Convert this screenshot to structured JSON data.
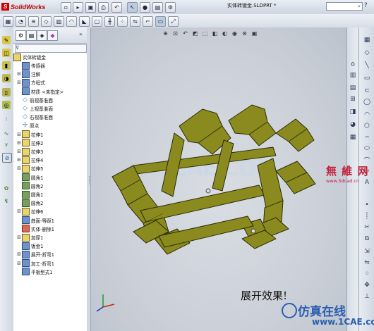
{
  "app": {
    "logo": "SolidWorks",
    "document_title": "实体转钣金.SLDPRT *",
    "search_placeholder": ""
  },
  "toolbar": {
    "top_icons": [
      "new-icon",
      "open-icon",
      "save-icon",
      "print-icon",
      "undo-icon",
      "select-icon",
      "rebuild-icon",
      "options-icon"
    ]
  },
  "feature_tree": {
    "root": "实体转钣金",
    "items": [
      {
        "label": "传感器",
        "icon": "sensor-icon",
        "expandable": false
      },
      {
        "label": "注解",
        "icon": "annotation-icon",
        "expandable": true
      },
      {
        "label": "方程式",
        "icon": "equation-icon",
        "expandable": true
      },
      {
        "label": "材质 <未指定>",
        "icon": "material-icon",
        "expandable": false
      },
      {
        "label": "前视基准面",
        "icon": "plane-icon",
        "expandable": false
      },
      {
        "label": "上视基准面",
        "icon": "plane-icon",
        "expandable": false
      },
      {
        "label": "右视基准面",
        "icon": "plane-icon",
        "expandable": false
      },
      {
        "label": "原点",
        "icon": "origin-icon",
        "expandable": false
      },
      {
        "label": "拉伸1",
        "icon": "extrude-icon",
        "expandable": true
      },
      {
        "label": "拉伸2",
        "icon": "extrude-icon",
        "expandable": true
      },
      {
        "label": "拉伸3",
        "icon": "extrude-icon",
        "expandable": true
      },
      {
        "label": "拉伸4",
        "icon": "extrude-icon",
        "expandable": true
      },
      {
        "label": "拉伸5",
        "icon": "extrude-icon",
        "expandable": true
      },
      {
        "label": "圆角1",
        "icon": "fillet-icon",
        "expandable": false
      },
      {
        "label": "圆角2",
        "icon": "fillet-icon",
        "expandable": false
      },
      {
        "label": "圆角1",
        "icon": "fillet-icon",
        "expandable": false
      },
      {
        "label": "圆角2",
        "icon": "fillet-icon",
        "expandable": false
      },
      {
        "label": "拉伸6",
        "icon": "extrude-icon",
        "expandable": true
      },
      {
        "label": "曲面-等距1",
        "icon": "surface-icon",
        "expandable": false
      },
      {
        "label": "实体-删除1",
        "icon": "delete-body-icon",
        "expandable": false
      },
      {
        "label": "加厚1",
        "icon": "thicken-icon",
        "expandable": true
      },
      {
        "label": "钣金1",
        "icon": "sheetmetal-icon",
        "expandable": false
      },
      {
        "label": "展开-折弯1",
        "icon": "unfold-icon",
        "expandable": true
      },
      {
        "label": "加工-折弯1",
        "icon": "process-bend-icon",
        "expandable": true
      },
      {
        "label": "平板型式1",
        "icon": "flat-pattern-icon",
        "expandable": false
      }
    ]
  },
  "viewport": {
    "caption": "展开效果!",
    "watermark": "1CAE.COM",
    "part_color": "#8a8a1e"
  },
  "overlays": {
    "stamp_main": "無 維 网",
    "stamp_url": "www.5dcad.cn",
    "brand_main": "仿真在线",
    "brand_url": "www.1CAE.com"
  }
}
